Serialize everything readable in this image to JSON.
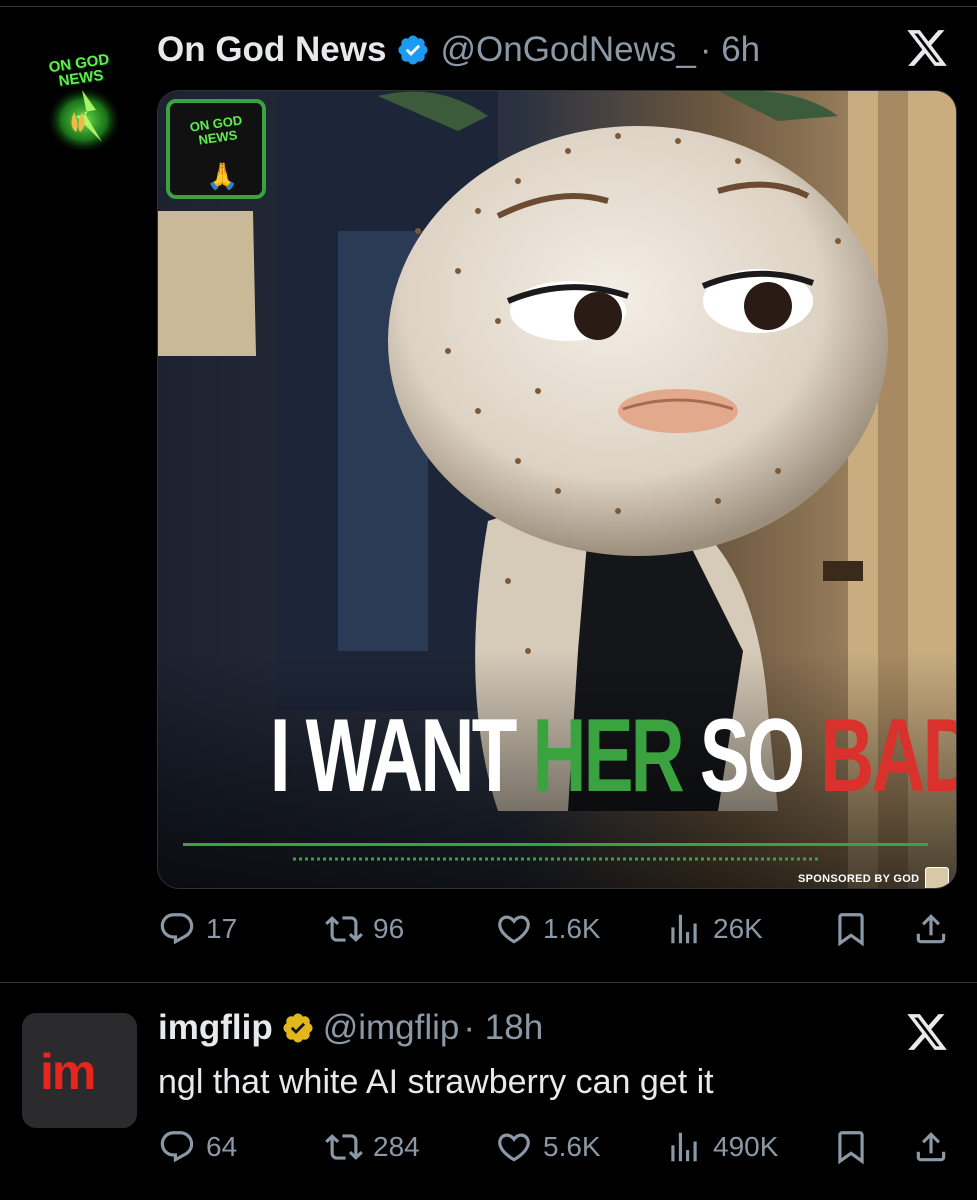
{
  "tweet1": {
    "display_name": "On God News",
    "handle": "@OnGodNews_",
    "time": "· 6h",
    "avatar_text": "ON GOD NEWS",
    "media": {
      "badge_text": "ON GOD NEWS",
      "caption_words": [
        "I WANT",
        "HER",
        "SO",
        "BAD"
      ],
      "sponsor_text": "SPONSORED BY GOD"
    },
    "replies": "17",
    "reposts": "96",
    "likes": "1.6K",
    "views": "26K"
  },
  "tweet2": {
    "display_name": "imgflip",
    "handle": "@imgflip",
    "time": "· 18h",
    "avatar_text": "im",
    "text": "ngl that white AI strawberry can get it",
    "replies": "64",
    "reposts": "284",
    "likes": "5.6K",
    "views": "490K"
  },
  "colors": {
    "background": "#000000",
    "verified_blue": "#1d9bf0",
    "verified_gold": "#e2b719",
    "caption_green": "#3aa33f",
    "caption_red": "#d9322c",
    "muted": "#8b98a5"
  },
  "icons": [
    "x-logo-icon",
    "verified-badge-icon",
    "reply-icon",
    "repost-icon",
    "like-icon",
    "views-icon",
    "bookmark-icon",
    "share-icon"
  ]
}
